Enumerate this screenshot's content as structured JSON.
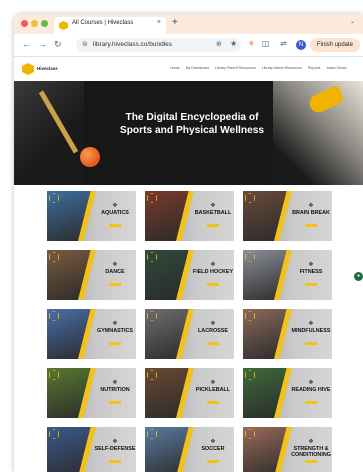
{
  "browser": {
    "tab_title": "All Courses | Hiveclass",
    "tab_close": "×",
    "new_tab": "+",
    "tab_menu": "⌄",
    "url": "library.hiveclass.co/bundles",
    "finish_update": "Finish update",
    "profile_initial": "N"
  },
  "site": {
    "logo_text": "Hiveclass",
    "nav": [
      "Home",
      "My Dashboard",
      "Library Parent Resources",
      "Library Admin Resources",
      "Reports",
      "Asian Studio"
    ]
  },
  "hero": {
    "title_line1": "The Digital Encyclopedia of",
    "title_line2": "Sports and Physical Wellness"
  },
  "categories": [
    {
      "label": "AQUATICS",
      "color": "#3d6f9e"
    },
    {
      "label": "BASKETBALL",
      "color": "#7a3a2a"
    },
    {
      "label": "BRAIN BREAK",
      "color": "#6b4a3a"
    },
    {
      "label": "DANCE",
      "color": "#7a5a3e"
    },
    {
      "label": "FIELD HOCKEY",
      "color": "#2f4a3c"
    },
    {
      "label": "FITNESS",
      "color": "#8a8f96"
    },
    {
      "label": "GYMNASTICS",
      "color": "#4a6ea8"
    },
    {
      "label": "LACROSSE",
      "color": "#6e6e6e"
    },
    {
      "label": "MINDFULNESS",
      "color": "#8a6a5a"
    },
    {
      "label": "NUTRITION",
      "color": "#5a7a2e"
    },
    {
      "label": "PICKLEBALL",
      "color": "#6a4a32"
    },
    {
      "label": "READING HIVE",
      "color": "#3e6a3a"
    },
    {
      "label": "SELF-DEFENSE",
      "color": "#3a5a8a"
    },
    {
      "label": "SOCCER",
      "color": "#5a7aa0"
    },
    {
      "label": "STRENGTH & CONDITIONING",
      "color": "#9a6a5a"
    }
  ]
}
